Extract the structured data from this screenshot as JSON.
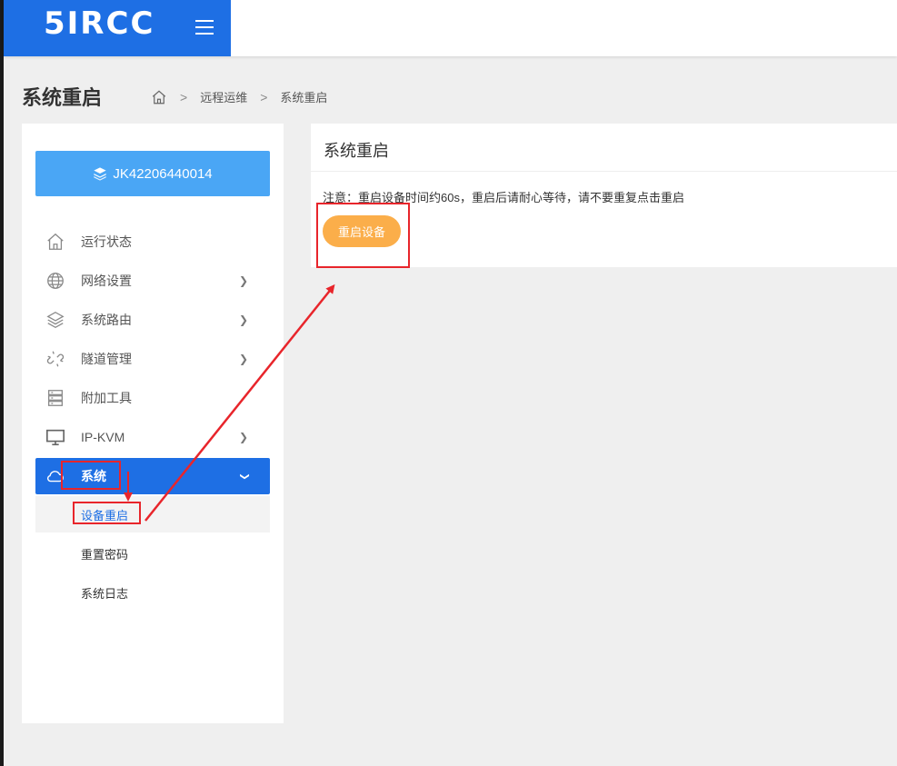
{
  "brand": {
    "logo_text": "5IRCC"
  },
  "header": {
    "page_title": "系统重启",
    "breadcrumb": [
      "远程运维",
      "系统重启"
    ]
  },
  "sidebar": {
    "device_id": "JK42206440014",
    "items": [
      {
        "label": "运行状态",
        "icon": "home-icon",
        "has_arrow": false
      },
      {
        "label": "网络设置",
        "icon": "globe-icon",
        "has_arrow": true
      },
      {
        "label": "系统路由",
        "icon": "layers-icon",
        "has_arrow": true
      },
      {
        "label": "隧道管理",
        "icon": "link-icon",
        "has_arrow": true
      },
      {
        "label": "附加工具",
        "icon": "server-icon",
        "has_arrow": true
      },
      {
        "label": "IP-KVM",
        "icon": "monitor-icon",
        "has_arrow": true
      },
      {
        "label": "系统",
        "icon": "cloud-icon",
        "has_arrow": true,
        "active": true
      }
    ],
    "sub_items": [
      {
        "label": "设备重启",
        "current": true
      },
      {
        "label": "重置密码"
      },
      {
        "label": "系统日志"
      }
    ]
  },
  "panel": {
    "title": "系统重启",
    "note": "注意：重启设备时间约60s，重启后请耐心等待，请不要重复点击重启",
    "reboot_button": "重启设备"
  },
  "colors": {
    "brand_blue": "#1e6fe4",
    "device_button": "#4aa6f5",
    "reboot_button": "#fbae4a",
    "annotation_red": "#e8252b"
  }
}
